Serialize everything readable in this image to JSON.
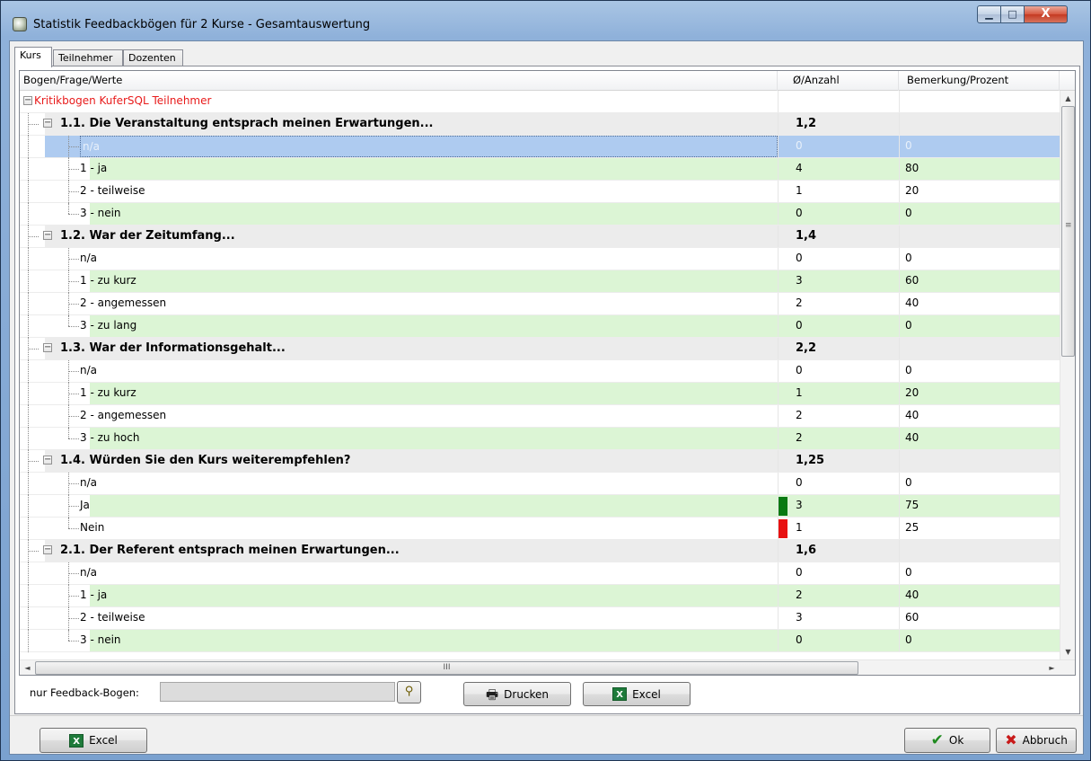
{
  "window": {
    "title": "Statistik Feedbackbögen für 2 Kurse - Gesamtauswertung",
    "min_glyph": "▁",
    "max_glyph": "□",
    "close_glyph": "X"
  },
  "tabs": [
    {
      "label": "Kurs"
    },
    {
      "label": "Teilnehmer"
    },
    {
      "label": "Dozenten"
    }
  ],
  "grid": {
    "headers": {
      "col1": "Bogen/Frage/Werte",
      "col2": "Ø/Anzahl",
      "col3": "Bemerkung/Prozent"
    },
    "root": {
      "label": "Kritikbogen KuferSQL Teilnehmer",
      "expander": "−"
    },
    "rows": [
      {
        "type": "q",
        "label": "1.1. Die Veranstaltung entsprach meinen Erwartungen...",
        "value": "1,2",
        "pct": ""
      },
      {
        "type": "a",
        "label": "n/a",
        "value": "0",
        "pct": "0",
        "selected": true,
        "alt": false
      },
      {
        "type": "a",
        "label": "1 - ja",
        "value": "4",
        "pct": "80",
        "alt": true
      },
      {
        "type": "a",
        "label": "2 - teilweise",
        "value": "1",
        "pct": "20",
        "alt": false
      },
      {
        "type": "a",
        "label": "3 - nein",
        "value": "0",
        "pct": "0",
        "alt": true,
        "last": true
      },
      {
        "type": "q",
        "label": "1.2. War der Zeitumfang...",
        "value": "1,4",
        "pct": ""
      },
      {
        "type": "a",
        "label": "n/a",
        "value": "0",
        "pct": "0",
        "alt": false
      },
      {
        "type": "a",
        "label": "1 - zu kurz",
        "value": "3",
        "pct": "60",
        "alt": true
      },
      {
        "type": "a",
        "label": "2 - angemessen",
        "value": "2",
        "pct": "40",
        "alt": false
      },
      {
        "type": "a",
        "label": "3 - zu lang",
        "value": "0",
        "pct": "0",
        "alt": true,
        "last": true
      },
      {
        "type": "q",
        "label": "1.3. War der Informationsgehalt...",
        "value": "2,2",
        "pct": ""
      },
      {
        "type": "a",
        "label": "n/a",
        "value": "0",
        "pct": "0",
        "alt": false
      },
      {
        "type": "a",
        "label": "1 - zu kurz",
        "value": "1",
        "pct": "20",
        "alt": true
      },
      {
        "type": "a",
        "label": "2 - angemessen",
        "value": "2",
        "pct": "40",
        "alt": false
      },
      {
        "type": "a",
        "label": "3 - zu hoch",
        "value": "2",
        "pct": "40",
        "alt": true,
        "last": true
      },
      {
        "type": "q",
        "label": "1.4. Würden Sie den Kurs weiterempfehlen?",
        "value": "1,25",
        "pct": ""
      },
      {
        "type": "a",
        "label": "n/a",
        "value": "0",
        "pct": "0",
        "alt": false
      },
      {
        "type": "a",
        "label": "Ja",
        "value": "3",
        "pct": "75",
        "alt": true,
        "marker": "#0a7a12"
      },
      {
        "type": "a",
        "label": "Nein",
        "value": "1",
        "pct": "25",
        "alt": false,
        "marker": "#e81111",
        "last": true
      },
      {
        "type": "q",
        "label": "2.1. Der Referent entsprach meinen Erwartungen...",
        "value": "1,6",
        "pct": ""
      },
      {
        "type": "a",
        "label": "n/a",
        "value": "0",
        "pct": "0",
        "alt": false
      },
      {
        "type": "a",
        "label": "1 - ja",
        "value": "2",
        "pct": "40",
        "alt": true
      },
      {
        "type": "a",
        "label": "2 - teilweise",
        "value": "3",
        "pct": "60",
        "alt": false
      },
      {
        "type": "a",
        "label": "3 - nein",
        "value": "0",
        "pct": "0",
        "alt": true,
        "last": true
      }
    ],
    "expander_glyph": "−",
    "scroll": {
      "up": "▲",
      "down": "▼",
      "left": "◄",
      "right": "►",
      "vgrip": "≡",
      "hgrip": "III"
    }
  },
  "filter": {
    "label": "nur Feedback-Bogen:",
    "value": "",
    "pick_icon": "pick-icon",
    "pick_glyph": "⚲",
    "print_label": "Drucken",
    "print_glyph": "🖶",
    "excel_label": "Excel",
    "excel_glyph": "X"
  },
  "footer": {
    "excel_label": "Excel",
    "excel_glyph": "X",
    "ok_label": "Ok",
    "ok_glyph": "✔",
    "cancel_label": "Abbruch",
    "cancel_glyph": "✖"
  },
  "colors": {
    "alt_row": "#dcf5d5",
    "question_row": "#ececec",
    "selected_row": "#aecbf0",
    "root_text": "#e81b1b"
  }
}
